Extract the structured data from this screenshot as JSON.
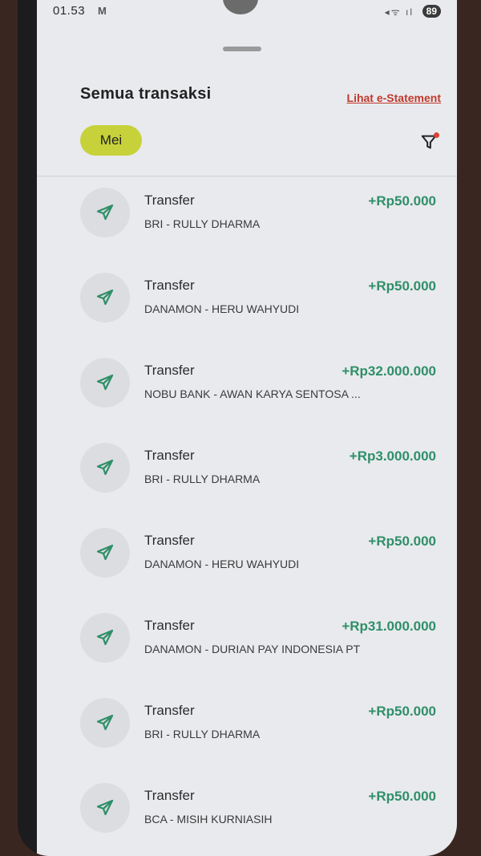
{
  "status_bar": {
    "time": "01.53",
    "mail_icon": "M",
    "battery": "89"
  },
  "header": {
    "title": "Semua transaksi",
    "estatement_link": "Lihat e-Statement"
  },
  "filter": {
    "month_chip": "Mei"
  },
  "transactions": [
    {
      "type": "Transfer",
      "party": "BRI - RULLY DHARMA",
      "amount": "+Rp50.000"
    },
    {
      "type": "Transfer",
      "party": "DANAMON - HERU WAHYUDI",
      "amount": "+Rp50.000"
    },
    {
      "type": "Transfer",
      "party": "NOBU BANK - AWAN KARYA SENTOSA ...",
      "amount": "+Rp32.000.000"
    },
    {
      "type": "Transfer",
      "party": "BRI - RULLY DHARMA",
      "amount": "+Rp3.000.000"
    },
    {
      "type": "Transfer",
      "party": "DANAMON - HERU WAHYUDI",
      "amount": "+Rp50.000"
    },
    {
      "type": "Transfer",
      "party": "DANAMON - DURIAN PAY INDONESIA PT",
      "amount": "+Rp31.000.000"
    },
    {
      "type": "Transfer",
      "party": "BRI - RULLY DHARMA",
      "amount": "+Rp50.000"
    },
    {
      "type": "Transfer",
      "party": "BCA - MISIH KURNIASIH",
      "amount": "+Rp50.000"
    }
  ],
  "icons": {
    "transaction": "paper-plane-icon",
    "filter": "filter-icon"
  },
  "colors": {
    "amount": "#2f8f68",
    "chip": "#c7d23a",
    "link": "#c0392b"
  }
}
